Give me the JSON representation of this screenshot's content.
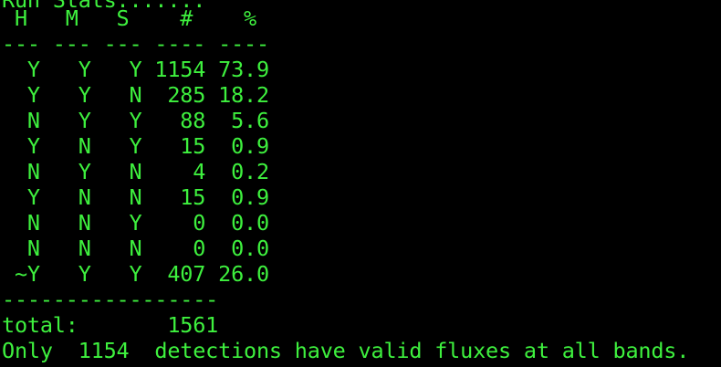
{
  "terminal": {
    "colors": {
      "background": "#000000",
      "text": "#3ef03e"
    },
    "partial_header": "Run Stats:......",
    "lines": [
      " H   M   S    #    %",
      "--- --- --- ---- ----",
      "  Y   Y   Y 1154 73.9",
      "  Y   Y   N  285 18.2",
      "  N   Y   Y   88  5.6",
      "  Y   N   Y   15  0.9",
      "  N   Y   N    4  0.2",
      "  Y   N   N   15  0.9",
      "  N   N   Y    0  0.0",
      "  N   N   N    0  0.0",
      " ~Y   Y   Y  407 26.0",
      "-----------------",
      "total:       1561",
      "Only  1154  detections have valid fluxes at all bands."
    ]
  }
}
